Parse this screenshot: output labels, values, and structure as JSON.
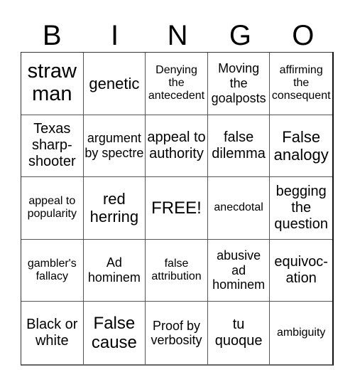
{
  "header": {
    "letters": [
      "B",
      "I",
      "N",
      "G",
      "O"
    ]
  },
  "cells": [
    {
      "text": "straw man",
      "size": "s28"
    },
    {
      "text": "genetic",
      "size": "s22"
    },
    {
      "text": "Denying the antecedent",
      "size": "s16"
    },
    {
      "text": "Moving the goalposts",
      "size": "s18"
    },
    {
      "text": "affirming the consequent",
      "size": "s16"
    },
    {
      "text": "Texas sharp-shooter",
      "size": "s20"
    },
    {
      "text": "argument by spectre",
      "size": "s18"
    },
    {
      "text": "appeal to authority",
      "size": "s20"
    },
    {
      "text": "false dilemma",
      "size": "s20"
    },
    {
      "text": "False analogy",
      "size": "s22"
    },
    {
      "text": "appeal to popularity",
      "size": "s16"
    },
    {
      "text": "red herring",
      "size": "s22"
    },
    {
      "text": "FREE!",
      "size": "s24"
    },
    {
      "text": "anecdotal",
      "size": "s16"
    },
    {
      "text": "begging the question",
      "size": "s20"
    },
    {
      "text": "gambler's fallacy",
      "size": "s16"
    },
    {
      "text": "Ad hominem",
      "size": "s18"
    },
    {
      "text": "false attribution",
      "size": "s16"
    },
    {
      "text": "abusive ad hominem",
      "size": "s18"
    },
    {
      "text": "equivoc-ation",
      "size": "s20"
    },
    {
      "text": "Black or white",
      "size": "s20"
    },
    {
      "text": "False cause",
      "size": "s24"
    },
    {
      "text": "Proof by verbosity",
      "size": "s18"
    },
    {
      "text": "tu quoque",
      "size": "s20"
    },
    {
      "text": "ambiguity",
      "size": "s16"
    }
  ]
}
